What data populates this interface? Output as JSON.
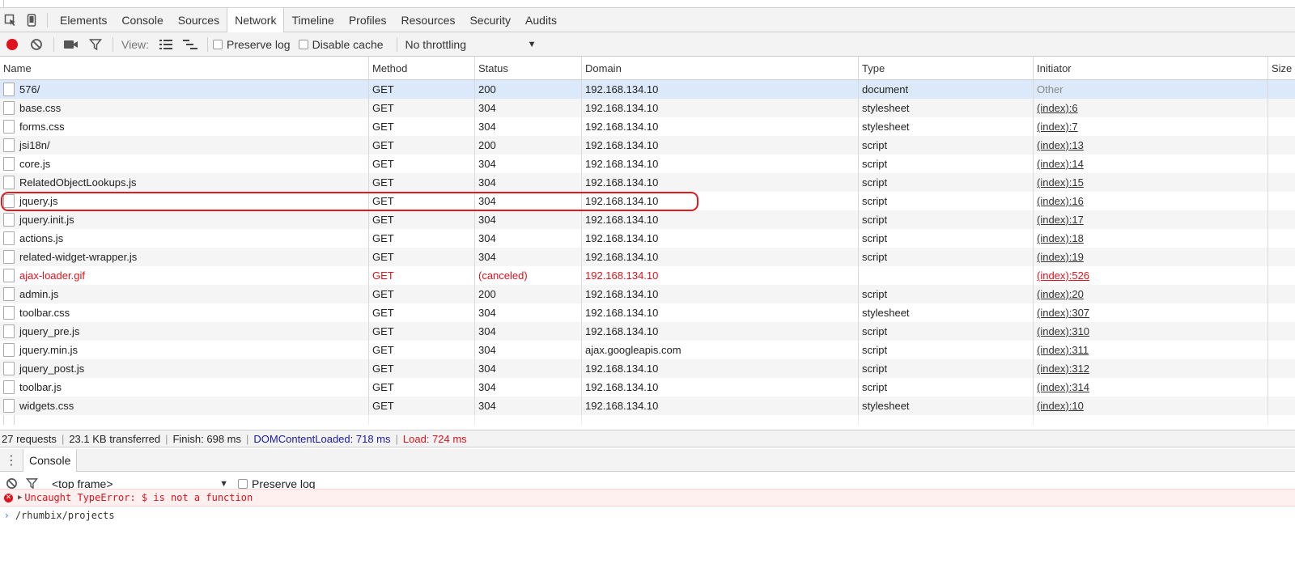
{
  "devtools": {
    "tabs": [
      {
        "label": "Elements",
        "active": false
      },
      {
        "label": "Console",
        "active": false
      },
      {
        "label": "Sources",
        "active": false
      },
      {
        "label": "Network",
        "active": true
      },
      {
        "label": "Timeline",
        "active": false
      },
      {
        "label": "Profiles",
        "active": false
      },
      {
        "label": "Resources",
        "active": false
      },
      {
        "label": "Security",
        "active": false
      },
      {
        "label": "Audits",
        "active": false
      }
    ]
  },
  "network_toolbar": {
    "view_label": "View:",
    "preserve_log": "Preserve log",
    "disable_cache": "Disable cache",
    "throttling": "No throttling"
  },
  "table": {
    "columns": [
      "Name",
      "Method",
      "Status",
      "Domain",
      "Type",
      "Initiator",
      "Size"
    ],
    "rows": [
      {
        "name": "576/",
        "method": "GET",
        "status": "200",
        "domain": "192.168.134.10",
        "type": "document",
        "initiator": "Other"
      },
      {
        "name": "base.css",
        "method": "GET",
        "status": "304",
        "domain": "192.168.134.10",
        "type": "stylesheet",
        "initiator": "(index):6"
      },
      {
        "name": "forms.css",
        "method": "GET",
        "status": "304",
        "domain": "192.168.134.10",
        "type": "stylesheet",
        "initiator": "(index):7"
      },
      {
        "name": "jsi18n/",
        "method": "GET",
        "status": "200",
        "domain": "192.168.134.10",
        "type": "script",
        "initiator": "(index):13"
      },
      {
        "name": "core.js",
        "method": "GET",
        "status": "304",
        "domain": "192.168.134.10",
        "type": "script",
        "initiator": "(index):14"
      },
      {
        "name": "RelatedObjectLookups.js",
        "method": "GET",
        "status": "304",
        "domain": "192.168.134.10",
        "type": "script",
        "initiator": "(index):15"
      },
      {
        "name": "jquery.js",
        "method": "GET",
        "status": "304",
        "domain": "192.168.134.10",
        "type": "script",
        "initiator": "(index):16"
      },
      {
        "name": "jquery.init.js",
        "method": "GET",
        "status": "304",
        "domain": "192.168.134.10",
        "type": "script",
        "initiator": "(index):17"
      },
      {
        "name": "actions.js",
        "method": "GET",
        "status": "304",
        "domain": "192.168.134.10",
        "type": "script",
        "initiator": "(index):18"
      },
      {
        "name": "related-widget-wrapper.js",
        "method": "GET",
        "status": "304",
        "domain": "192.168.134.10",
        "type": "script",
        "initiator": "(index):19"
      },
      {
        "name": "ajax-loader.gif",
        "method": "GET",
        "status": "(canceled)",
        "domain": "192.168.134.10",
        "type": "",
        "initiator": "(index):526"
      },
      {
        "name": "admin.js",
        "method": "GET",
        "status": "200",
        "domain": "192.168.134.10",
        "type": "script",
        "initiator": "(index):20"
      },
      {
        "name": "toolbar.css",
        "method": "GET",
        "status": "304",
        "domain": "192.168.134.10",
        "type": "stylesheet",
        "initiator": "(index):307"
      },
      {
        "name": "jquery_pre.js",
        "method": "GET",
        "status": "304",
        "domain": "192.168.134.10",
        "type": "script",
        "initiator": "(index):310"
      },
      {
        "name": "jquery.min.js",
        "method": "GET",
        "status": "304",
        "domain": "ajax.googleapis.com",
        "type": "script",
        "initiator": "(index):311"
      },
      {
        "name": "jquery_post.js",
        "method": "GET",
        "status": "304",
        "domain": "192.168.134.10",
        "type": "script",
        "initiator": "(index):312"
      },
      {
        "name": "toolbar.js",
        "method": "GET",
        "status": "304",
        "domain": "192.168.134.10",
        "type": "script",
        "initiator": "(index):314"
      },
      {
        "name": "widgets.css",
        "method": "GET",
        "status": "304",
        "domain": "192.168.134.10",
        "type": "stylesheet",
        "initiator": "(index):10"
      }
    ]
  },
  "summary": {
    "requests": "27 requests",
    "transferred": "23.1 KB transferred",
    "finish": "Finish: 698 ms",
    "dcl": "DOMContentLoaded: 718 ms",
    "load": "Load: 724 ms"
  },
  "drawer": {
    "tab": "Console",
    "frame": "<top frame>",
    "preserve_log": "Preserve log",
    "error_message": "Uncaught TypeError: $ is not a function",
    "input_echo": "/rhumbix/projects"
  },
  "colors": {
    "error": "#e0121d",
    "selection": "#dbe9fb",
    "dcl": "#1a1aa6",
    "highlight_ring": "#e31a1c"
  },
  "icons": [
    "inspect-icon",
    "device-icon",
    "record-icon",
    "clear-icon",
    "camera-icon",
    "filter-icon",
    "list-view-icon",
    "waterfall-view-icon",
    "file-icon",
    "kebab-icon",
    "error-icon",
    "expand-triangle-icon",
    "prompt-chevron-icon"
  ]
}
